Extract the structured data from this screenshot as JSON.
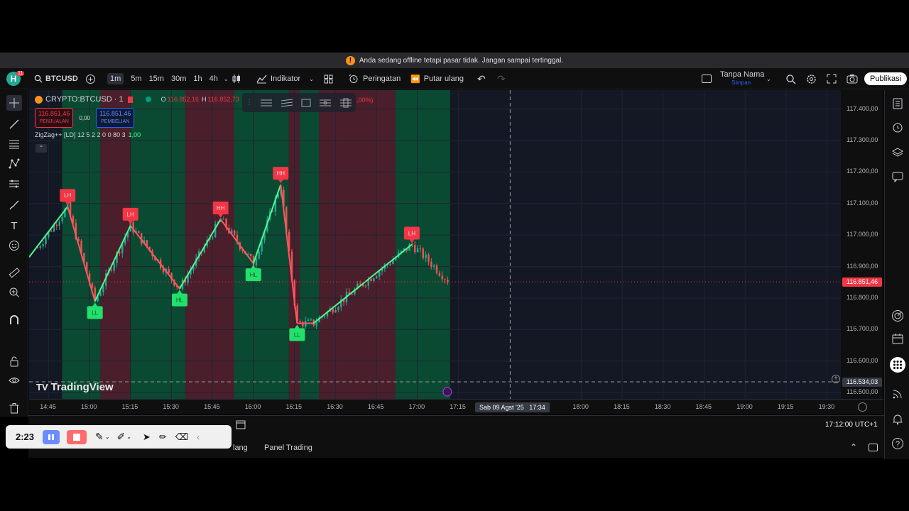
{
  "banner": {
    "text": "Anda sedang offline tetapi pasar tidak. Jangan sampai tertinggal."
  },
  "toolbar": {
    "avatar_letter": "H",
    "notif_count": "11",
    "symbol": "BTCUSD",
    "timeframes": [
      "1m",
      "5m",
      "15m",
      "30m",
      "1h",
      "4h"
    ],
    "active_timeframe": "1m",
    "indicators_label": "Indikator",
    "alerts_label": "Peringatan",
    "replay_label": "Putar ulang",
    "layout_name": "Tanpa Nama",
    "layout_status": "Simpan",
    "publish_label": "Publikasi"
  },
  "legend": {
    "symbol_title": "CRYPTO:BTCUSD · 1",
    "ohlc_prefix_o": "O",
    "ohlc_o": "116.852,16",
    "ohlc_prefix_h": "H",
    "ohlc_h": "116.852,73",
    "change": ",00%)",
    "sell_price": "116.851,46",
    "sell_label": "PENJUALAN",
    "spread": "0,00",
    "buy_price": "116.851,46",
    "buy_label": "PEMBELIAN",
    "indicator": "ZigZag++ [LD] 12 5 2 2 0 0 80 3",
    "indicator_value": "1,00"
  },
  "watermark": "TradingView",
  "colors": {
    "bg": "#141824",
    "zone_green": "#0b4a32",
    "zone_red": "#4a1f2b",
    "zigzag_up": "#4cff8a",
    "zigzag_down": "#ff5566",
    "candle_up": "#26a69a",
    "candle_down": "#ef5350",
    "label_high": "#f23645",
    "label_low": "#22e06b"
  },
  "price_axis": {
    "ticks": [
      "117.400,00",
      "117.300,00",
      "117.200,00",
      "117.100,00",
      "117.000,00",
      "116.900,00",
      "116.800,00",
      "116.700,00",
      "116.600,00",
      "116.500,00"
    ],
    "current_price": "116.851,46",
    "crosshair_price": "116.534,03"
  },
  "time_axis": {
    "ticks": [
      "14:45",
      "15:00",
      "15:15",
      "15:30",
      "15:45",
      "16:00",
      "16:15",
      "16:30",
      "16:45",
      "17:00",
      "17:15",
      "18:00",
      "18:15",
      "18:30",
      "18:45",
      "19:00",
      "19:15",
      "19:30"
    ],
    "crosshair_label": "Sab 09 Agst '25   17:34"
  },
  "chart_data": {
    "type": "line",
    "x": [
      "14:52",
      "15:02",
      "15:15",
      "15:33",
      "15:48",
      "16:00",
      "16:10",
      "16:16",
      "16:22",
      "16:58"
    ],
    "series": [
      {
        "values": [
          117090,
          116790,
          117030,
          116830,
          117050,
          116910,
          117160,
          116720,
          116720,
          116970
        ]
      }
    ],
    "swing_labels": [
      "LH",
      "LL",
      "LH",
      "HL",
      "HH",
      "HL",
      "HH",
      "LL",
      "LH"
    ],
    "ylim": [
      116480,
      117460
    ]
  },
  "bottom": {
    "clock": "17:12:00 UTC+1",
    "tab_partial": "lang",
    "panel_label": "Panel Trading"
  },
  "recorder": {
    "time": "2:23"
  }
}
